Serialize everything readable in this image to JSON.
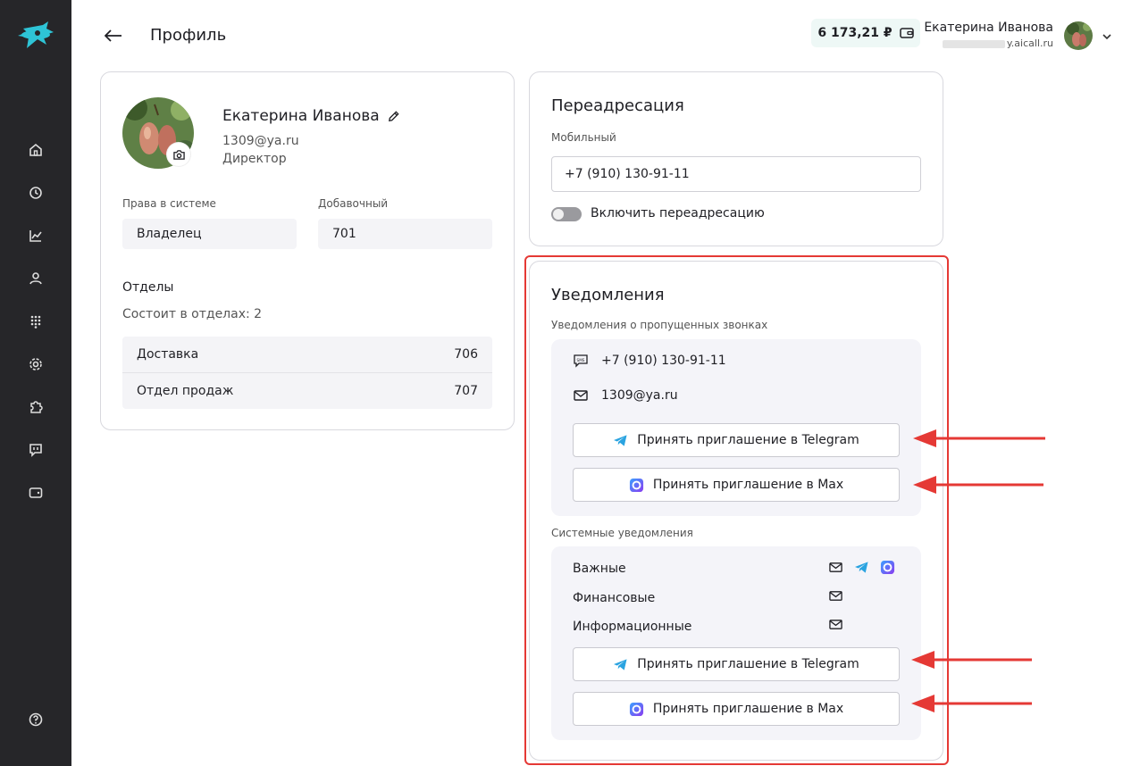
{
  "header": {
    "title": "Профиль",
    "balance": "6 173,21 ₽",
    "user_name": "Екатерина Иванова",
    "user_email_suffix": "y.aicall.ru"
  },
  "profile": {
    "name": "Екатерина Иванова",
    "email": "1309@ya.ru",
    "role": "Директор",
    "rights_label": "Права в системе",
    "rights_value": "Владелец",
    "ext_label": "Добавочный",
    "ext_value": "701",
    "departments_title": "Отделы",
    "departments_count": "Состоит в отделах: 2",
    "departments": [
      {
        "name": "Доставка",
        "code": "706"
      },
      {
        "name": "Отдел продаж",
        "code": "707"
      }
    ]
  },
  "forwarding": {
    "title": "Переадресация",
    "mobile_label": "Мобильный",
    "mobile_value": "+7 (910) 130-91-11",
    "toggle_label": "Включить переадресацию"
  },
  "notifications": {
    "title": "Уведомления",
    "missed_label": "Уведомления о пропущенных звонках",
    "missed_phone": "+7 (910) 130-91-11",
    "missed_email": "1309@ya.ru",
    "telegram_btn": "Принять приглашение в Telegram",
    "max_btn": "Принять приглашение в Max",
    "system_label": "Системные уведомления",
    "system_rows": [
      "Важные",
      "Финансовые",
      "Информационные"
    ]
  },
  "colors": {
    "sidebar": "#262629",
    "accent": "#2ec4d6",
    "highlight": "#e53935",
    "telegram": "#2aa3e0",
    "max": "#5b4ff0"
  }
}
